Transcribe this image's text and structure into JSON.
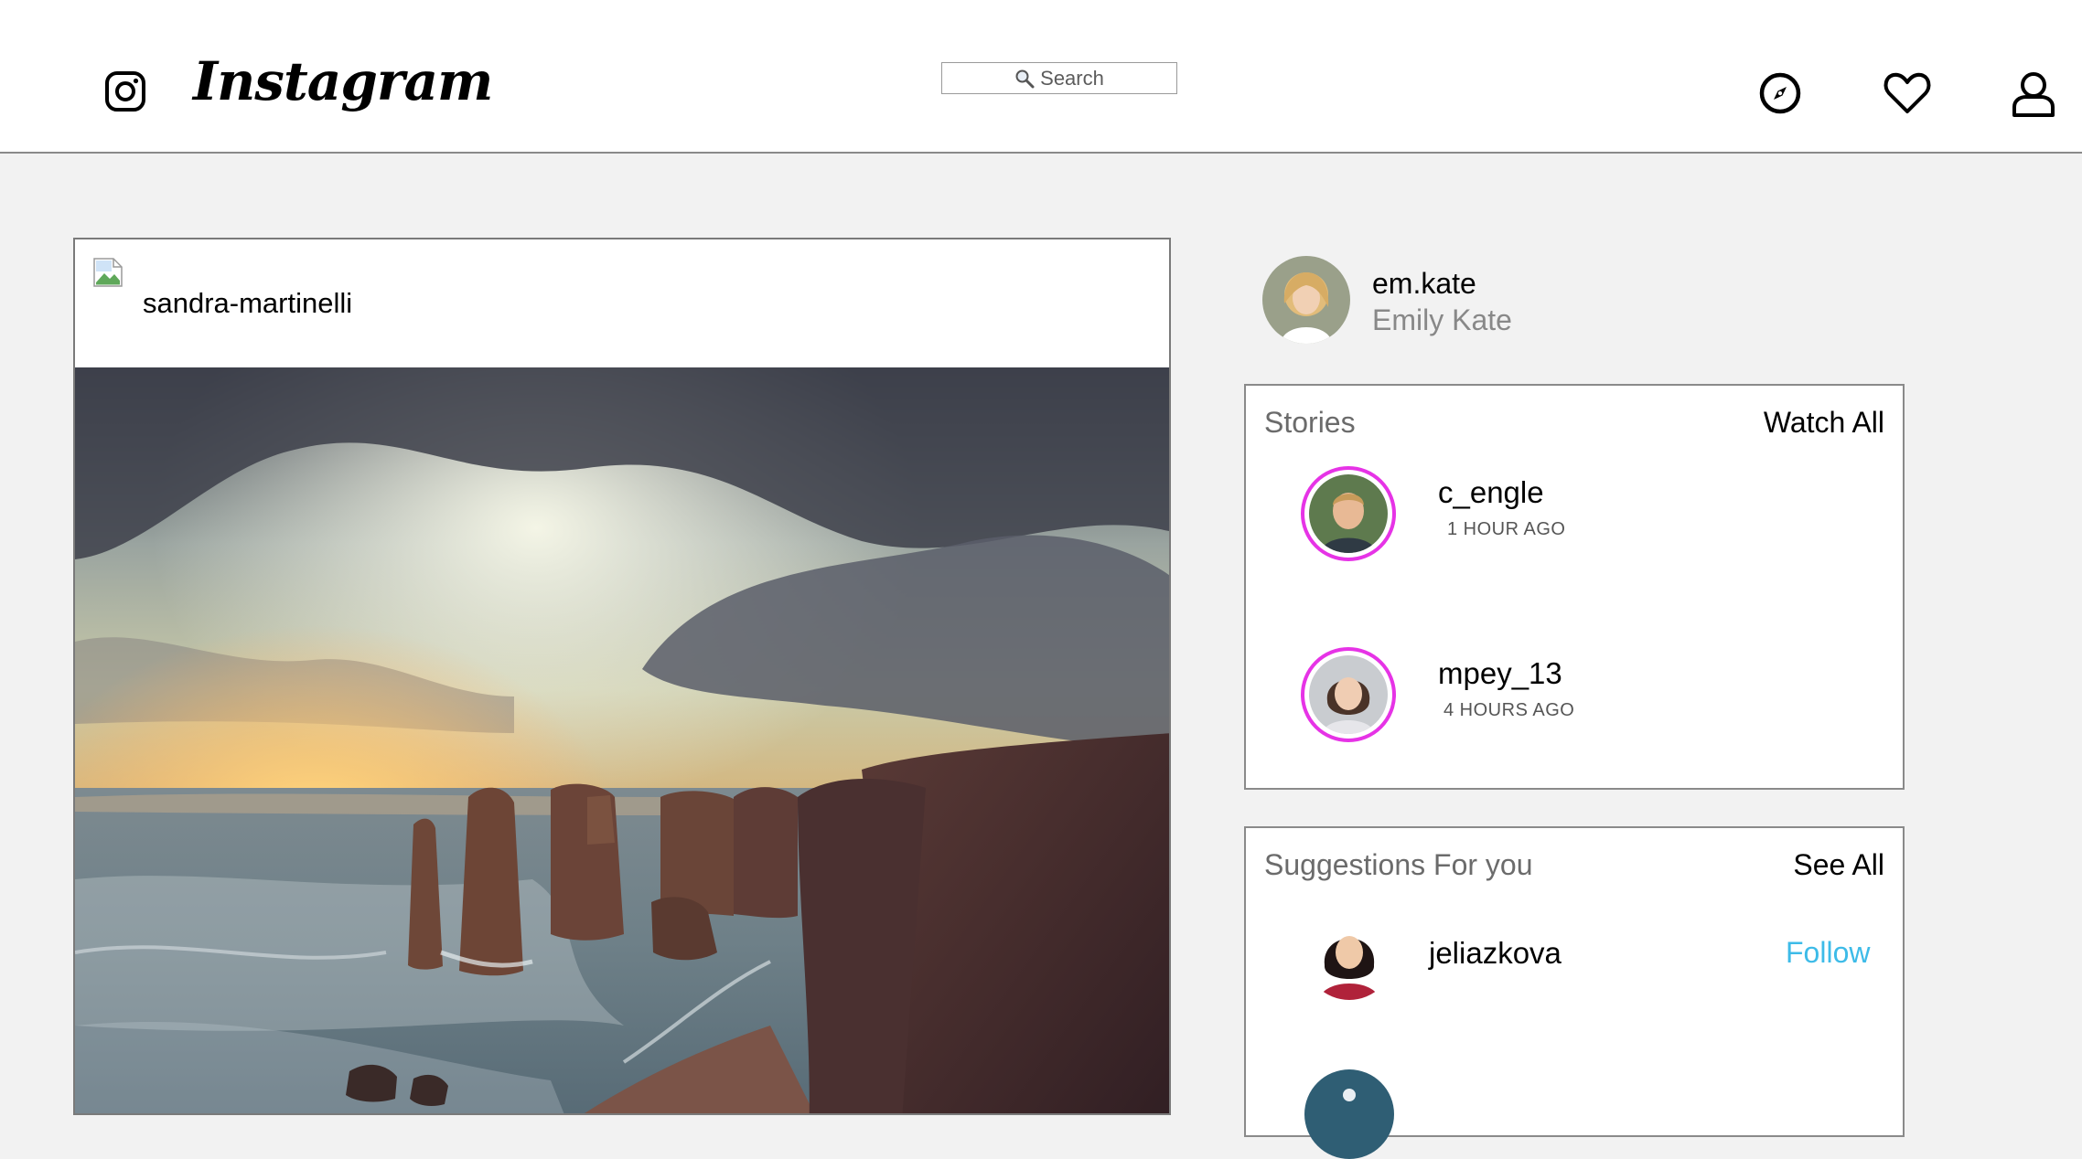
{
  "header": {
    "brand": "Instagram",
    "search_placeholder": "Search",
    "nav_icons": [
      "explore-icon",
      "heart-icon",
      "profile-icon"
    ]
  },
  "post": {
    "username": "sandra-martinelli",
    "photo": "coastal-cliffs-sunset"
  },
  "profile": {
    "username": "em.kate",
    "full_name": "Emily Kate"
  },
  "stories": {
    "title": "Stories",
    "action": "Watch All",
    "items": [
      {
        "username": "c_engle",
        "time": "1 HOUR AGO"
      },
      {
        "username": "mpey_13",
        "time": "4 HOURS AGO"
      }
    ]
  },
  "suggestions": {
    "title": "Suggestions For you",
    "action": "See All",
    "items": [
      {
        "username": "jeliazkova",
        "action": "Follow"
      }
    ]
  },
  "colors": {
    "story_ring": "#e633e6",
    "follow": "#3dbbe8",
    "muted_text": "#888888",
    "page_bg": "#f2f2f2"
  }
}
